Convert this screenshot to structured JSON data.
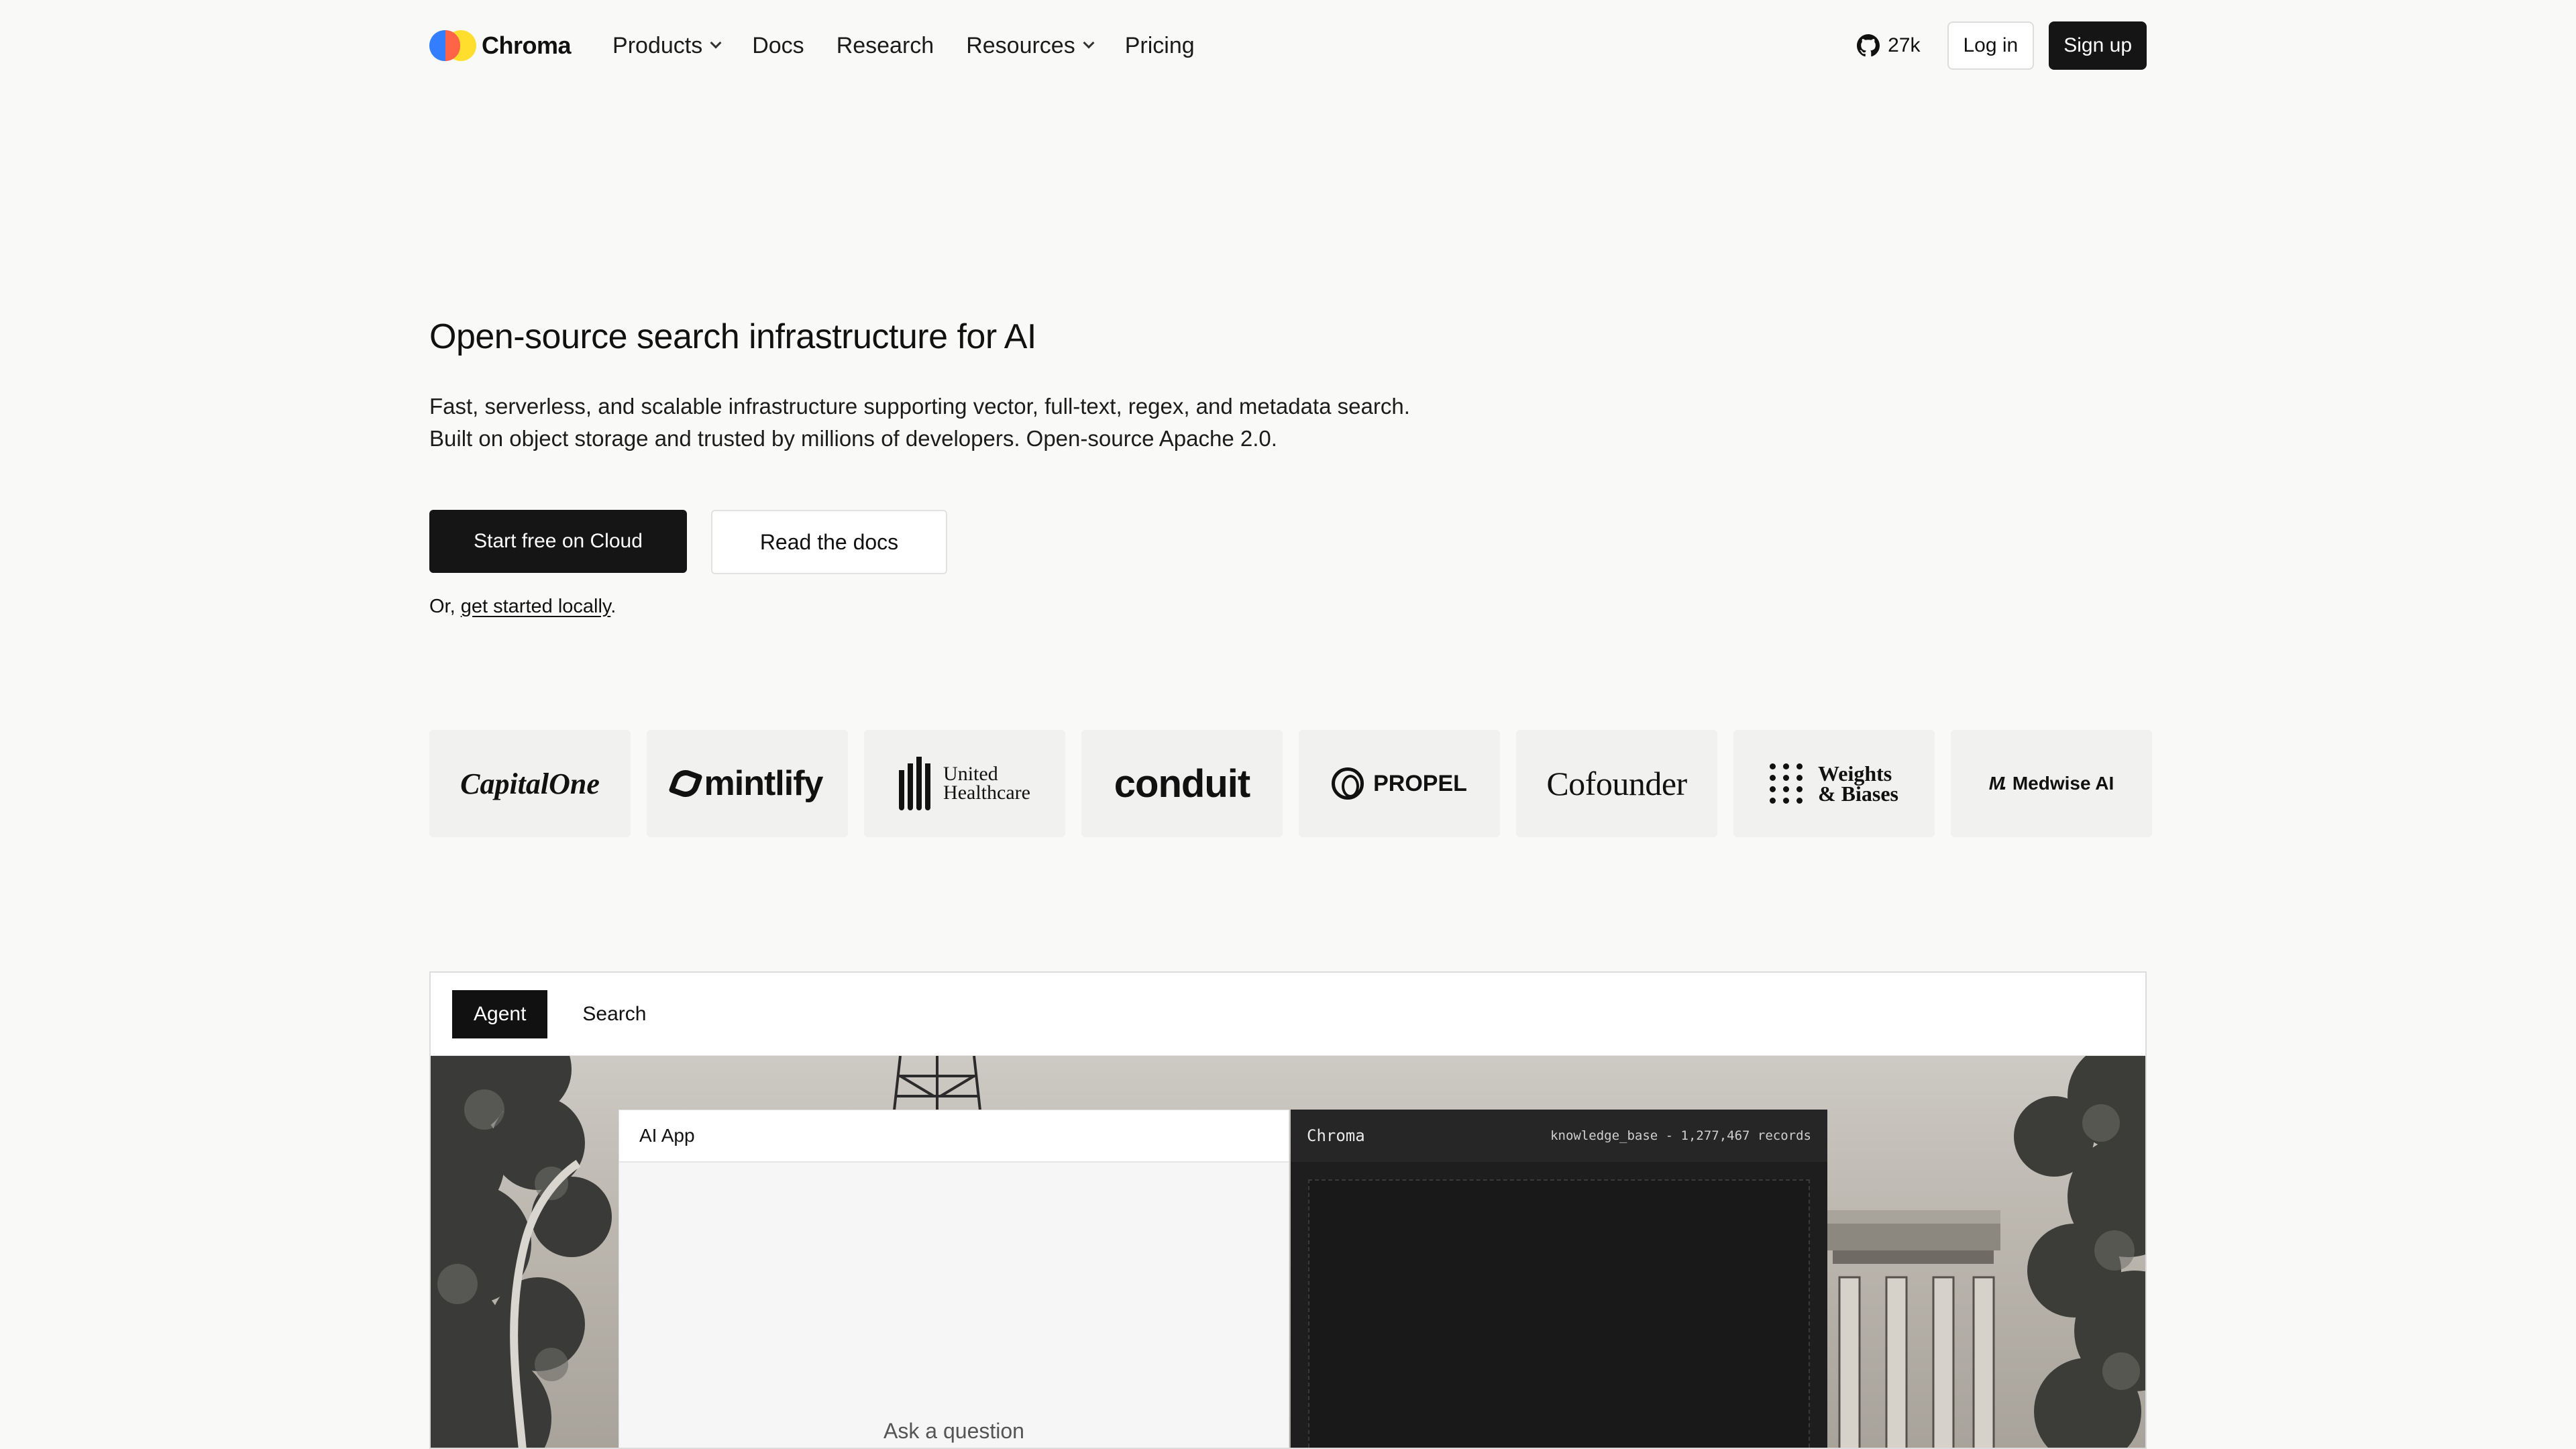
{
  "nav": {
    "brand": "Chroma",
    "links": [
      {
        "label": "Products",
        "dropdown": true
      },
      {
        "label": "Docs",
        "dropdown": false
      },
      {
        "label": "Research",
        "dropdown": false
      },
      {
        "label": "Resources",
        "dropdown": true
      },
      {
        "label": "Pricing",
        "dropdown": false
      }
    ],
    "github_stars": "27k",
    "github_icon": "github-icon",
    "login_label": "Log in",
    "signup_label": "Sign up"
  },
  "hero": {
    "title": "Open-source search infrastructure for AI",
    "description": "Fast, serverless, and scalable infrastructure supporting vector, full-text, regex, and metadata search. Built on object storage and trusted by millions of developers. Open-source Apache 2.0.",
    "primary_cta": "Start free on Cloud",
    "secondary_cta": "Read the docs",
    "local_prefix": "Or, ",
    "local_link": "get started locally",
    "local_suffix": "."
  },
  "customers": {
    "capital_one": "CapitalOne",
    "mintlify": "mintlify",
    "uhc_line1": "United",
    "uhc_line2": "Healthcare",
    "conduit": "conduit",
    "propel": "PROPEL",
    "cofounder": "Cofounder",
    "wb_line1": "Weights",
    "wb_line2": "& Biases",
    "medwise_mark": "M.",
    "medwise": "Medwise AI"
  },
  "demo": {
    "tabs": [
      {
        "label": "Agent",
        "active": true
      },
      {
        "label": "Search",
        "active": false
      }
    ],
    "ai_panel_title": "AI App",
    "ai_placeholder": "Ask a question",
    "db_title": "Chroma",
    "db_meta": "knowledge_base - 1,277,467 records"
  },
  "colors": {
    "background": "#f9f9f8",
    "primary_button": "#151515",
    "logo_blue": "#327eff",
    "logo_yellow": "#ffde2d",
    "logo_red": "#ff6446",
    "db_panel": "#1e1e1e"
  }
}
